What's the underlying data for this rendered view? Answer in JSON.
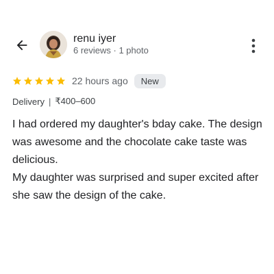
{
  "header": {
    "back_icon": "arrow-left-icon",
    "more_icon": "more-vertical-icon"
  },
  "reviewer": {
    "name": "renu iyer",
    "meta": "6 reviews · 1 photo"
  },
  "rating": {
    "stars": 5,
    "max_stars": 5,
    "star_color": "#fbbc04",
    "time_ago": "22 hours ago",
    "badge": "New"
  },
  "details": {
    "type": "Delivery",
    "separator": "|",
    "price": "₹400–600"
  },
  "review": {
    "paragraph_1": "I had ordered my daughter's bday cake. The design was awesome and the chocolate cake taste was delicious.",
    "paragraph_2": "My daughter was surprised and super excited after she saw the design of the cake."
  }
}
